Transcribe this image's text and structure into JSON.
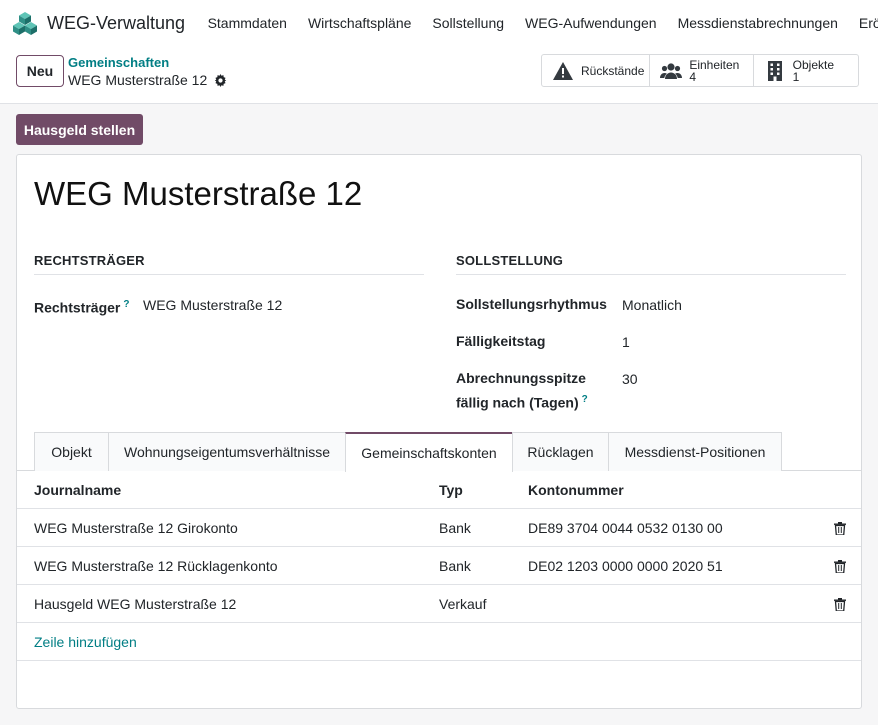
{
  "app": {
    "title": "WEG-Verwaltung",
    "menu": [
      "Stammdaten",
      "Wirtschaftspläne",
      "Sollstellung",
      "WEG-Aufwendungen",
      "Messdienstabrechnungen",
      "Eröffn"
    ]
  },
  "control_panel": {
    "new_label": "Neu",
    "breadcrumb_parent": "Gemeinschaften",
    "breadcrumb_current": "WEG Musterstraße 12",
    "smart_buttons": [
      {
        "label": "Rückstände",
        "value": "",
        "icon": "warning-icon"
      },
      {
        "label": "Einheiten",
        "value": "4",
        "icon": "users-icon"
      },
      {
        "label": "Objekte",
        "value": "1",
        "icon": "building-icon"
      }
    ]
  },
  "actions": {
    "primary_label": "Hausgeld stellen"
  },
  "record": {
    "title": "WEG Musterstraße 12",
    "groups": {
      "left_title": "Rechtsträger",
      "right_title": "Sollstellung"
    },
    "fields": {
      "rechtstraeger_label": "Rechtsträger",
      "rechtstraeger_value": "WEG Musterstraße 12",
      "rhythmus_label": "Sollstellungsrhythmus",
      "rhythmus_value": "Monatlich",
      "faelligkeitstag_label": "Fälligkeitstag",
      "faelligkeitstag_value": "1",
      "spitze_label_line1": "Abrechnungsspitze",
      "spitze_label_line2": "fällig nach (Tagen)",
      "spitze_value": "30",
      "help_mark": "?"
    }
  },
  "tabs": [
    "Objekt",
    "Wohnungseigentumsverhältnisse",
    "Gemeinschaftskonten",
    "Rücklagen",
    "Messdienst-Positionen"
  ],
  "active_tab": "Gemeinschaftskonten",
  "table": {
    "columns": [
      "Journalname",
      "Typ",
      "Kontonummer"
    ],
    "rows": [
      {
        "journal": "WEG Musterstraße 12 Girokonto",
        "typ": "Bank",
        "konto": "DE89 3704 0044 0532 0130 00"
      },
      {
        "journal": "WEG Musterstraße 12 Rücklagenkonto",
        "typ": "Bank",
        "konto": "DE02 1203 0000 0000 2020 51"
      },
      {
        "journal": "Hausgeld WEG Musterstraße 12",
        "typ": "Verkauf",
        "konto": ""
      }
    ],
    "add_line_label": "Zeile hinzufügen"
  },
  "colors": {
    "brand": "#714b67",
    "link": "#017e84",
    "warning": "#343a40"
  }
}
